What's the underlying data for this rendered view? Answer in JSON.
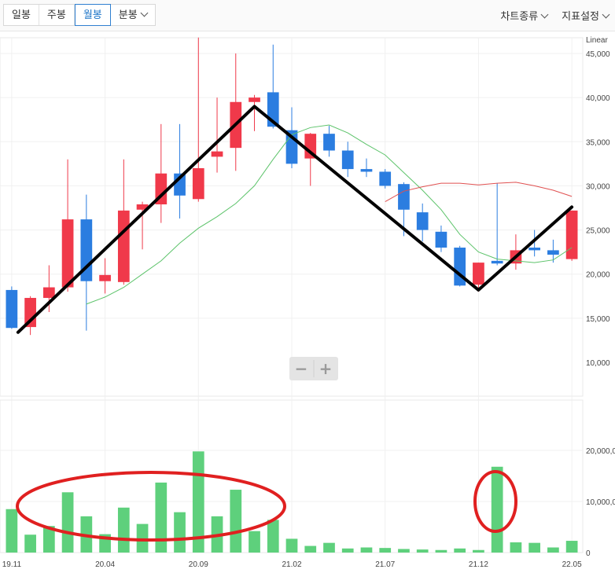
{
  "toolbar": {
    "periods": [
      {
        "label": "일봉",
        "active": false
      },
      {
        "label": "주봉",
        "active": false
      },
      {
        "label": "월봉",
        "active": true
      },
      {
        "label": "분봉",
        "active": false,
        "dropdown": true
      }
    ],
    "chart_type_label": "차트종류",
    "indicator_label": "지표설정"
  },
  "scale_label": "Linear",
  "zoom": {
    "minus": "−",
    "plus": "+"
  },
  "colors": {
    "up": "#f0394a",
    "down": "#2b7de0",
    "volume": "#5ed07c",
    "ma_short": "#5cc36a",
    "ma_long": "#e05050",
    "annotation": "#e02020",
    "trend": "#000000"
  },
  "chart_data": [
    {
      "type": "candlestick",
      "title": "",
      "scale": "linear",
      "ylim": [
        10000,
        48000
      ],
      "y_ticks": [
        "10,000",
        "15,000",
        "20,000",
        "25,000",
        "30,000",
        "35,000",
        "40,000",
        "45,000"
      ],
      "x_ticks": [
        "19.11",
        "20.04",
        "20.09",
        "21.02",
        "21.07",
        "21.12",
        "22.05"
      ],
      "candles": [
        {
          "d": "19.11",
          "o": 18200,
          "h": 18600,
          "l": 13800,
          "c": 13900
        },
        {
          "d": "19.12",
          "o": 14000,
          "h": 17500,
          "l": 13100,
          "c": 17300
        },
        {
          "d": "20.01",
          "o": 17300,
          "h": 21000,
          "l": 15700,
          "c": 18500
        },
        {
          "d": "20.02",
          "o": 18500,
          "h": 33000,
          "l": 18000,
          "c": 26200
        },
        {
          "d": "20.03",
          "o": 26200,
          "h": 29000,
          "l": 13600,
          "c": 19200
        },
        {
          "d": "20.04",
          "o": 19200,
          "h": 21800,
          "l": 17800,
          "c": 19900
        },
        {
          "d": "20.05",
          "o": 19100,
          "h": 33000,
          "l": 18800,
          "c": 27200
        },
        {
          "d": "20.06",
          "o": 27300,
          "h": 28200,
          "l": 22800,
          "c": 27900
        },
        {
          "d": "20.07",
          "o": 27900,
          "h": 37000,
          "l": 25800,
          "c": 31400
        },
        {
          "d": "20.08",
          "o": 31400,
          "h": 37000,
          "l": 26300,
          "c": 28900
        },
        {
          "d": "20.09",
          "o": 28500,
          "h": 46800,
          "l": 28200,
          "c": 32000
        },
        {
          "d": "20.10",
          "o": 33300,
          "h": 40000,
          "l": 31500,
          "c": 33900
        },
        {
          "d": "20.11",
          "o": 34300,
          "h": 45000,
          "l": 31700,
          "c": 39500
        },
        {
          "d": "20.12",
          "o": 39500,
          "h": 40300,
          "l": 36200,
          "c": 40000
        },
        {
          "d": "21.01",
          "o": 40600,
          "h": 46000,
          "l": 36500,
          "c": 36700
        },
        {
          "d": "21.02",
          "o": 36300,
          "h": 38900,
          "l": 32000,
          "c": 32500
        },
        {
          "d": "21.03",
          "o": 33100,
          "h": 36000,
          "l": 30000,
          "c": 35900
        },
        {
          "d": "21.04",
          "o": 35900,
          "h": 36800,
          "l": 33300,
          "c": 34000
        },
        {
          "d": "21.05",
          "o": 34000,
          "h": 35000,
          "l": 31000,
          "c": 31900
        },
        {
          "d": "21.06",
          "o": 31900,
          "h": 33100,
          "l": 31000,
          "c": 31600
        },
        {
          "d": "21.07",
          "o": 31600,
          "h": 31900,
          "l": 29700,
          "c": 30000
        },
        {
          "d": "21.08",
          "o": 30200,
          "h": 30400,
          "l": 24300,
          "c": 27300
        },
        {
          "d": "21.09",
          "o": 27000,
          "h": 28000,
          "l": 23700,
          "c": 25000
        },
        {
          "d": "21.10",
          "o": 24800,
          "h": 25500,
          "l": 22500,
          "c": 23000
        },
        {
          "d": "21.11",
          "o": 23000,
          "h": 23200,
          "l": 18600,
          "c": 18700
        },
        {
          "d": "21.12",
          "o": 18800,
          "h": 21300,
          "l": 18000,
          "c": 21300
        },
        {
          "d": "22.01",
          "o": 21500,
          "h": 30300,
          "l": 21000,
          "c": 21200
        },
        {
          "d": "22.02",
          "o": 21200,
          "h": 24500,
          "l": 20500,
          "c": 22700
        },
        {
          "d": "22.03",
          "o": 23000,
          "h": 25000,
          "l": 22000,
          "c": 22700
        },
        {
          "d": "22.04",
          "o": 22700,
          "h": 23900,
          "l": 21300,
          "c": 22200
        },
        {
          "d": "22.05",
          "o": 21700,
          "h": 27200,
          "l": 21500,
          "c": 27200
        }
      ],
      "moving_averages": [
        {
          "values": [
            null,
            null,
            null,
            null,
            16600,
            17400,
            18500,
            20000,
            21500,
            23500,
            25200,
            26500,
            28000,
            30000,
            33000,
            35800,
            36600,
            36900,
            36000,
            34700,
            33500,
            31500,
            29500,
            27300,
            24500,
            22500,
            21700,
            21500,
            21300,
            21600,
            23000
          ]
        },
        {
          "values": [
            null,
            null,
            null,
            null,
            null,
            null,
            null,
            null,
            null,
            null,
            null,
            null,
            null,
            null,
            null,
            null,
            null,
            null,
            null,
            null,
            28200,
            29400,
            29900,
            30300,
            30300,
            30100,
            30300,
            30400,
            30000,
            29500,
            28800
          ]
        }
      ]
    },
    {
      "type": "bar",
      "title": "",
      "ylim": [
        0,
        30000000
      ],
      "y_ticks": [
        "0",
        "10,000,0",
        "20,000,0"
      ],
      "values": [
        8500000,
        3500000,
        5200000,
        11800000,
        7100000,
        3600000,
        8800000,
        5600000,
        13700000,
        7900000,
        19800000,
        7100000,
        12300000,
        4200000,
        6400000,
        2700000,
        1300000,
        1900000,
        800000,
        1000000,
        900000,
        700000,
        600000,
        500000,
        800000,
        500000,
        16800000,
        2000000,
        1900000,
        1000000,
        2300000
      ]
    }
  ]
}
